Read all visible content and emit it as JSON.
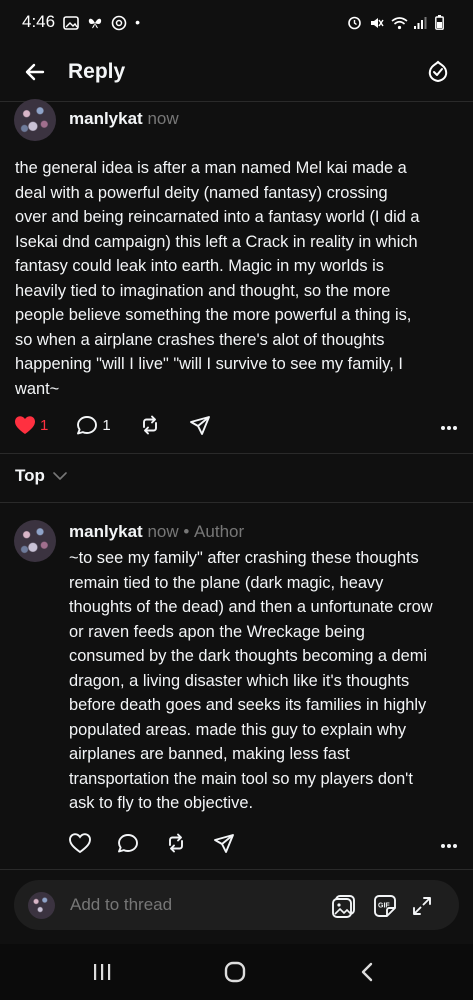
{
  "status_bar": {
    "time": "4:46"
  },
  "header": {
    "title": "Reply"
  },
  "post1": {
    "username": "manlykat",
    "time": "now",
    "text": "the general idea is after a man named Mel kai made a\ndeal with a powerful deity (named fantasy) crossing\nover and being reincarnated into a fantasy world (I did a\nIsekai dnd campaign) this left a Crack in reality in which\nfantasy could leak into earth. Magic in my worlds is\nheavily tied to imagination and thought, so the more\npeople believe something the more powerful a thing is,\nso when a airplane crashes there's alot of thoughts\nhappening \"will I live\" \"will I survive to see my family, I\nwant~",
    "like_count": "1",
    "reply_count": "1",
    "like_color": "#ff3040"
  },
  "sort": {
    "label": "Top"
  },
  "post2": {
    "username": "manlykat",
    "time": "now",
    "author_tag": "Author",
    "separator": "•",
    "text": "~to see my family\" after crashing these thoughts\nremain tied to the plane (dark magic, heavy\nthoughts of the dead) and then a unfortunate crow\nor raven feeds apon the Wreckage being\nconsumed by the dark thoughts becoming a demi\ndragon, a living disaster which like it's thoughts\nbefore death goes and seeks its families in highly\npopulated areas. made this guy to explain why\nairplanes are banned, making less fast\ntransportation the main tool so my players don't\nask to fly to the objective."
  },
  "composer": {
    "placeholder": "Add to thread"
  },
  "icons": {
    "back": "arrow-left-icon",
    "bell": "notification-bell-icon",
    "like": "heart-icon",
    "reply": "comment-icon",
    "repost": "repost-icon",
    "share": "send-icon",
    "more": "more-horizontal-icon",
    "chevron": "chevron-down-icon",
    "image": "image-icon",
    "gif": "gif-icon",
    "expand": "expand-icon",
    "recents": "recents-icon",
    "home": "home-icon",
    "nav_back": "chevron-left-icon"
  }
}
